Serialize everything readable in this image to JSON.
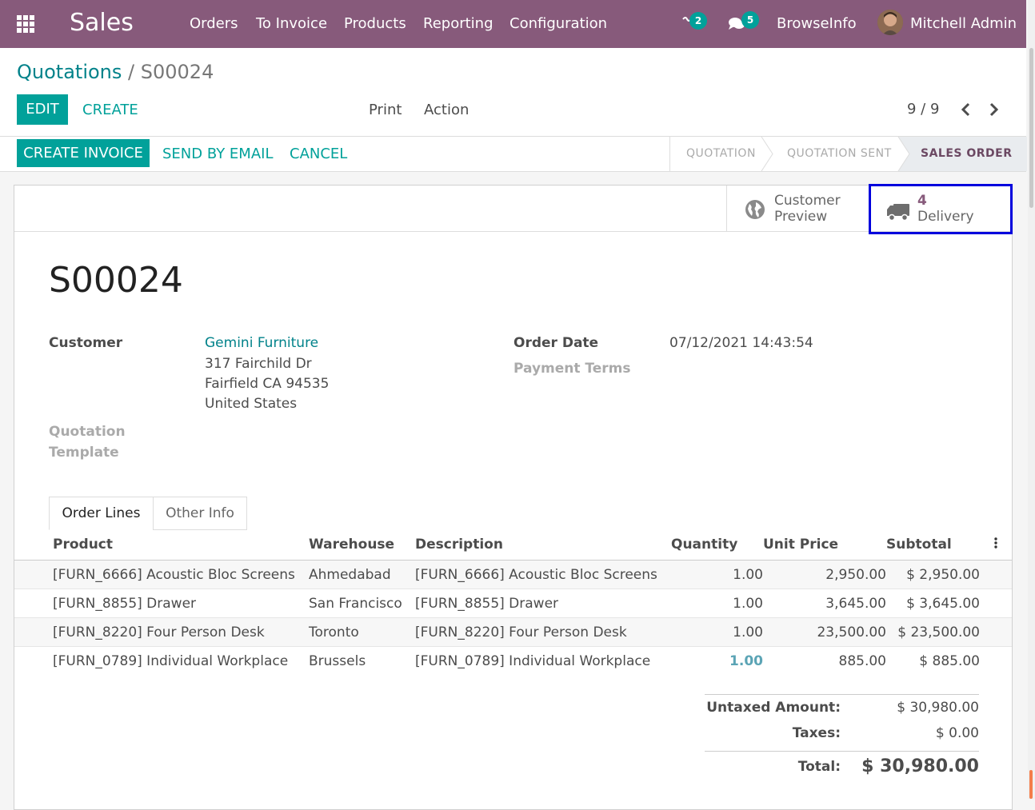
{
  "navbar": {
    "app_name": "Sales",
    "menus": [
      "Orders",
      "To Invoice",
      "Products",
      "Reporting",
      "Configuration"
    ],
    "activity_count": "2",
    "messages_count": "5",
    "company": "BrowseInfo",
    "user": "Mitchell Admin",
    "bg_color": "#875a7b"
  },
  "control": {
    "breadcrumb_parent": "Quotations",
    "breadcrumb_sep": "/",
    "breadcrumb_current": "S00024",
    "edit_label": "EDIT",
    "create_label": "CREATE",
    "print_label": "Print",
    "action_label": "Action",
    "pager": "9 / 9"
  },
  "statusbar": {
    "create_invoice": "CREATE INVOICE",
    "send_email": "SEND BY EMAIL",
    "cancel": "CANCEL",
    "stages": [
      "QUOTATION",
      "QUOTATION SENT",
      "SALES ORDER"
    ],
    "active_stage": "SALES ORDER"
  },
  "buttonbox": {
    "preview_line1": "Customer",
    "preview_line2": "Preview",
    "delivery_count": "4",
    "delivery_label": "Delivery"
  },
  "order": {
    "name": "S00024",
    "customer_label": "Customer",
    "customer_name": "Gemini Furniture",
    "address_1": "317 Fairchild Dr",
    "address_2": "Fairfield CA 94535",
    "address_3": "United States",
    "quotation_template_label_1": "Quotation",
    "quotation_template_label_2": "Template",
    "order_date_label": "Order Date",
    "order_date": "07/12/2021 14:43:54",
    "payment_terms_label": "Payment Terms"
  },
  "tabs": [
    "Order Lines",
    "Other Info"
  ],
  "lines": {
    "headers": [
      "Product",
      "Warehouse",
      "Description",
      "Quantity",
      "Unit Price",
      "Subtotal"
    ],
    "rows": [
      [
        "[FURN_6666] Acoustic Bloc Screens",
        "Ahmedabad",
        "[FURN_6666] Acoustic Bloc Screens",
        "1.00",
        "2,950.00",
        "$ 2,950.00"
      ],
      [
        "[FURN_8855] Drawer",
        "San Francisco",
        "[FURN_8855] Drawer",
        "1.00",
        "3,645.00",
        "$ 3,645.00"
      ],
      [
        "[FURN_8220] Four Person Desk",
        "Toronto",
        "[FURN_8220] Four Person Desk",
        "1.00",
        "23,500.00",
        "$ 23,500.00"
      ],
      [
        "[FURN_0789] Individual Workplace",
        "Brussels",
        "[FURN_0789] Individual Workplace",
        "1.00",
        "885.00",
        "$ 885.00"
      ]
    ]
  },
  "totals": {
    "untaxed_label": "Untaxed Amount:",
    "untaxed": "$ 30,980.00",
    "taxes_label": "Taxes:",
    "taxes": "$ 0.00",
    "total_label": "Total:",
    "total": "$ 30,980.00"
  },
  "colors": {
    "primary": "#01a19a",
    "link": "#01828a",
    "highlight_border": "#0000dd"
  }
}
